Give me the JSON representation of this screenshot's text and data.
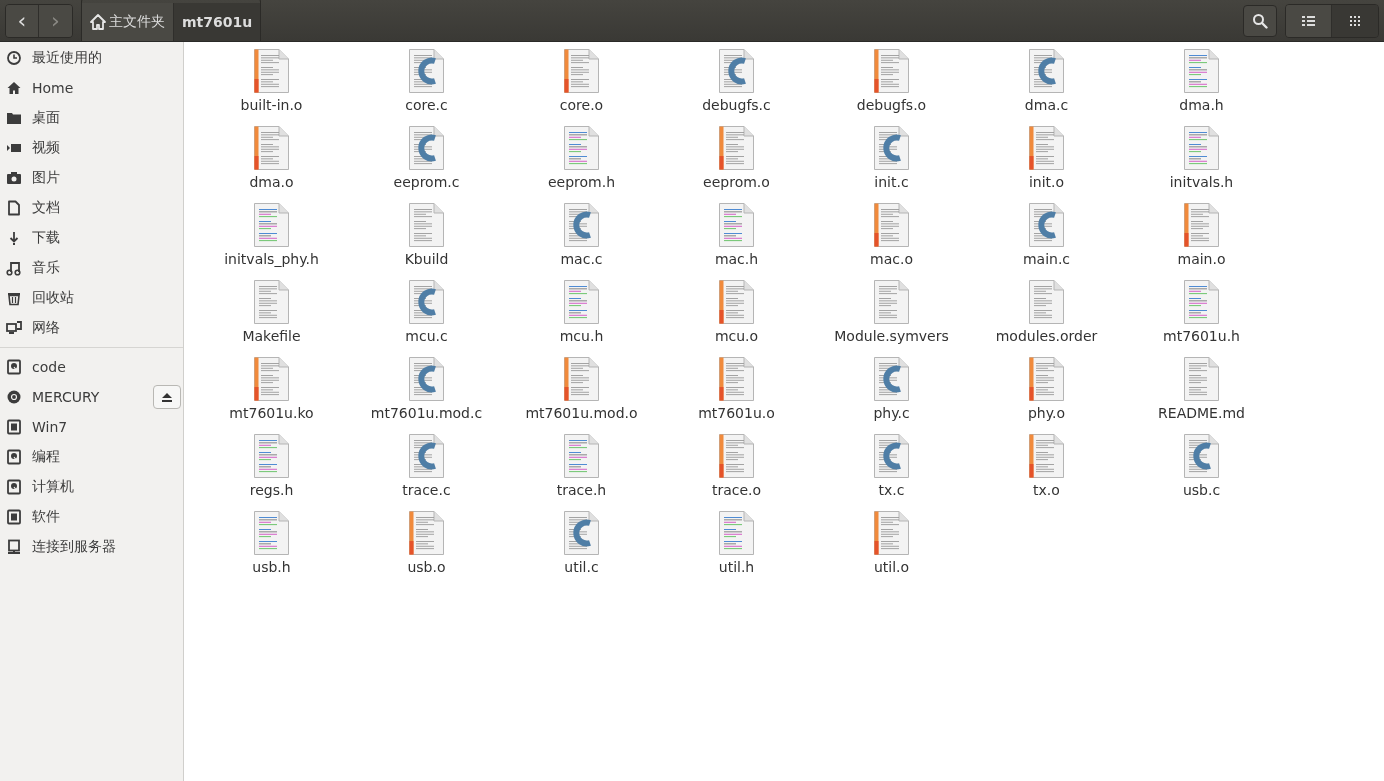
{
  "header": {
    "nav_buttons": [
      {
        "label": "‹",
        "disabled": false
      },
      {
        "label": "›",
        "disabled": true
      }
    ],
    "breadcrumbs": [
      {
        "label": "主文件夹",
        "kind": "home",
        "selected": false
      },
      {
        "label": "mt7601u",
        "kind": "folder",
        "selected": true
      }
    ],
    "view_buttons": [
      {
        "kind": "list",
        "selected": false
      },
      {
        "kind": "grid",
        "selected": true
      }
    ]
  },
  "sidebar": {
    "places": [
      {
        "label": "最近使用的"
      },
      {
        "label": "Home"
      },
      {
        "label": "桌面"
      },
      {
        "label": "视频"
      },
      {
        "label": "图片"
      },
      {
        "label": "文档"
      },
      {
        "label": "下载"
      },
      {
        "label": "音乐"
      },
      {
        "label": "回收站"
      },
      {
        "label": "网络"
      }
    ],
    "devices": [
      {
        "label": "code",
        "eject": false
      },
      {
        "label": "MERCURY",
        "eject": true
      },
      {
        "label": "Win7",
        "eject": false
      },
      {
        "label": "编程",
        "eject": false
      },
      {
        "label": "计算机",
        "eject": false
      },
      {
        "label": "软件",
        "eject": false
      },
      {
        "label": "连接到服务器",
        "eject": false
      }
    ]
  },
  "files": [
    {
      "name": "built-in.o",
      "kind": "object"
    },
    {
      "name": "core.c",
      "kind": "csource"
    },
    {
      "name": "core.o",
      "kind": "object"
    },
    {
      "name": "debugfs.c",
      "kind": "csource"
    },
    {
      "name": "debugfs.o",
      "kind": "object"
    },
    {
      "name": "dma.c",
      "kind": "csource"
    },
    {
      "name": "dma.h",
      "kind": "header"
    },
    {
      "name": "dma.o",
      "kind": "object"
    },
    {
      "name": "eeprom.c",
      "kind": "csource"
    },
    {
      "name": "eeprom.h",
      "kind": "header"
    },
    {
      "name": "eeprom.o",
      "kind": "object"
    },
    {
      "name": "init.c",
      "kind": "csource"
    },
    {
      "name": "init.o",
      "kind": "object"
    },
    {
      "name": "initvals.h",
      "kind": "header"
    },
    {
      "name": "initvals_phy.h",
      "kind": "header"
    },
    {
      "name": "Kbuild",
      "kind": "text"
    },
    {
      "name": "mac.c",
      "kind": "csource"
    },
    {
      "name": "mac.h",
      "kind": "header"
    },
    {
      "name": "mac.o",
      "kind": "object"
    },
    {
      "name": "main.c",
      "kind": "csource"
    },
    {
      "name": "main.o",
      "kind": "object"
    },
    {
      "name": "Makefile",
      "kind": "text"
    },
    {
      "name": "mcu.c",
      "kind": "csource"
    },
    {
      "name": "mcu.h",
      "kind": "header"
    },
    {
      "name": "mcu.o",
      "kind": "object"
    },
    {
      "name": "Module.symvers",
      "kind": "text"
    },
    {
      "name": "modules.order",
      "kind": "text"
    },
    {
      "name": "mt7601u.h",
      "kind": "header"
    },
    {
      "name": "mt7601u.ko",
      "kind": "object"
    },
    {
      "name": "mt7601u.mod.c",
      "kind": "csource"
    },
    {
      "name": "mt7601u.mod.o",
      "kind": "object"
    },
    {
      "name": "mt7601u.o",
      "kind": "object"
    },
    {
      "name": "phy.c",
      "kind": "csource"
    },
    {
      "name": "phy.o",
      "kind": "object"
    },
    {
      "name": "README.md",
      "kind": "text"
    },
    {
      "name": "regs.h",
      "kind": "header"
    },
    {
      "name": "trace.c",
      "kind": "csource"
    },
    {
      "name": "trace.h",
      "kind": "header"
    },
    {
      "name": "trace.o",
      "kind": "object"
    },
    {
      "name": "tx.c",
      "kind": "csource"
    },
    {
      "name": "tx.o",
      "kind": "object"
    },
    {
      "name": "usb.c",
      "kind": "csource"
    },
    {
      "name": "usb.h",
      "kind": "header"
    },
    {
      "name": "usb.o",
      "kind": "object"
    },
    {
      "name": "util.c",
      "kind": "csource"
    },
    {
      "name": "util.h",
      "kind": "header"
    },
    {
      "name": "util.o",
      "kind": "object"
    }
  ]
}
